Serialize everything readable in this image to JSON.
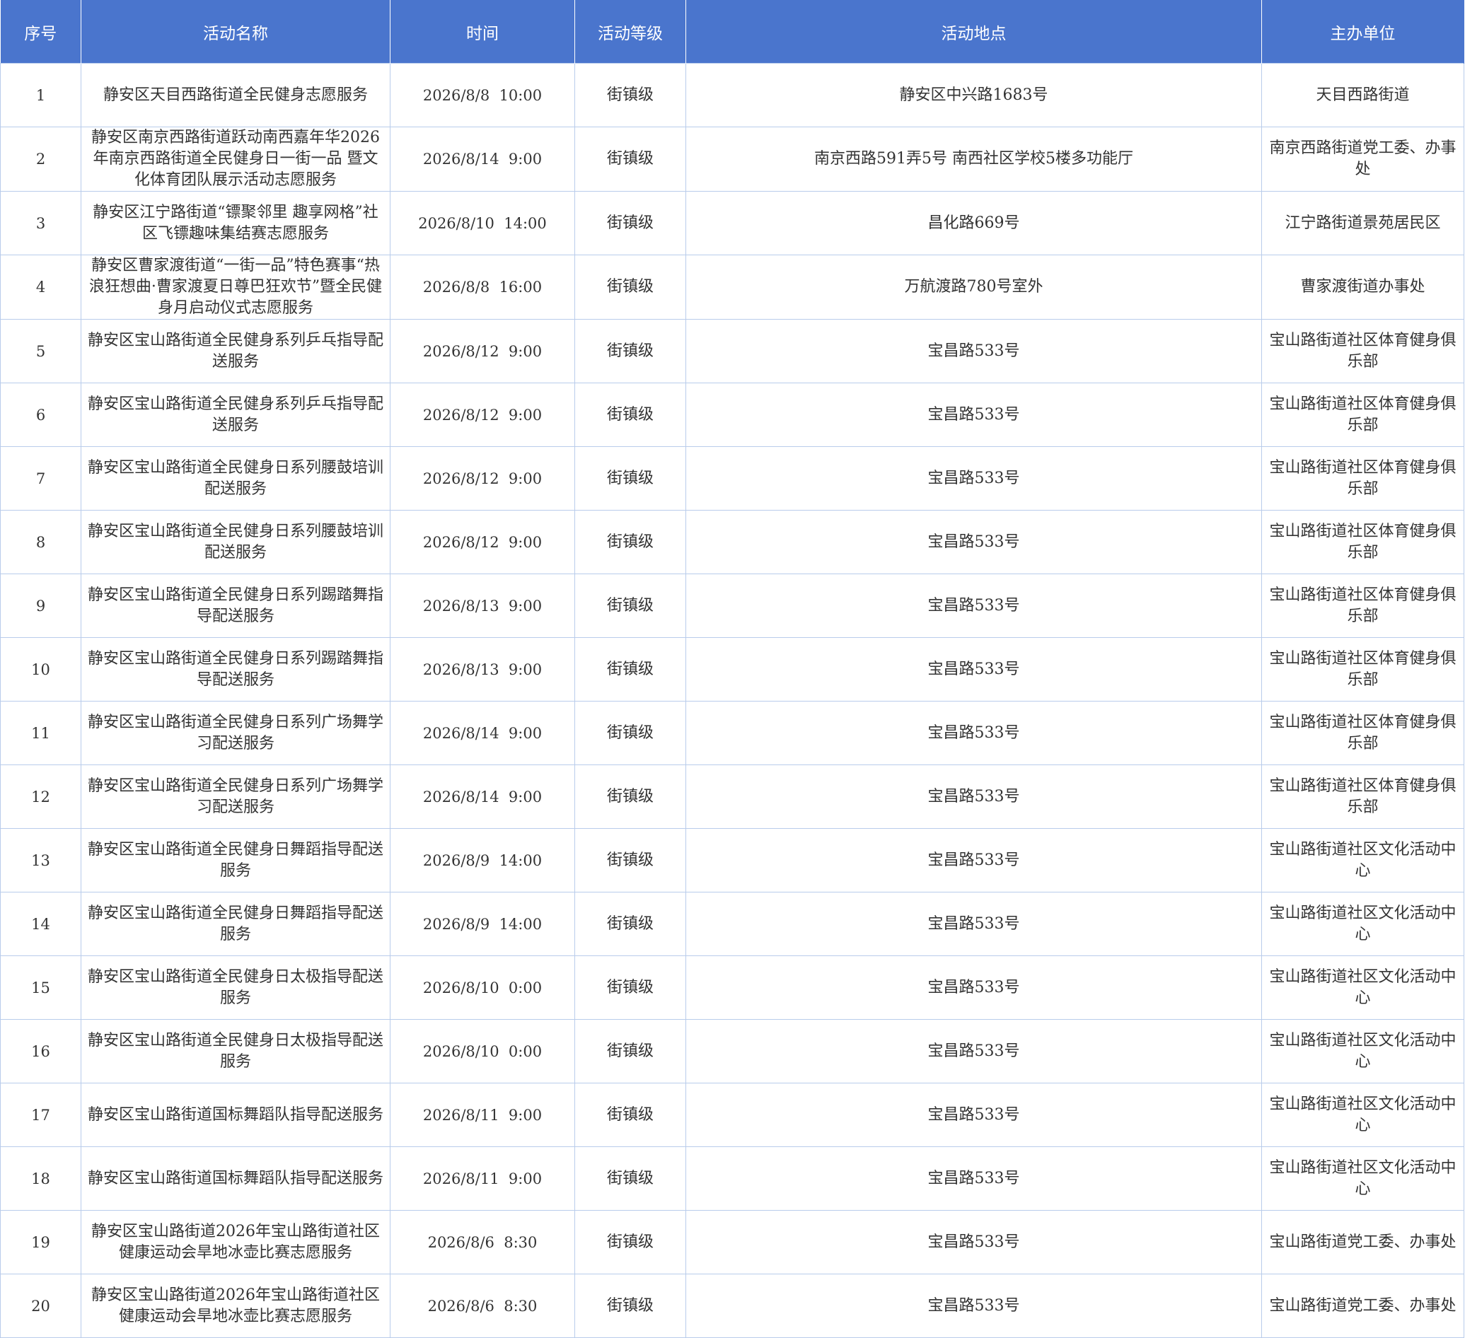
{
  "table": {
    "headers": [
      "序号",
      "活动名称",
      "时间",
      "活动等级",
      "活动地点",
      "主办单位"
    ],
    "rows": [
      [
        "1",
        "静安区天目西路街道全民健身志愿服务",
        "2026/8/8  10:00",
        "街镇级",
        "静安区中兴路1683号",
        "天目西路街道"
      ],
      [
        "2",
        "静安区南京西路街道跃动南西嘉年华2026年南京西路街道全民健身日一街一品 暨文化体育团队展示活动志愿服务",
        "2026/8/14  9:00",
        "街镇级",
        "南京西路591弄5号 南西社区学校5楼多功能厅",
        "南京西路街道党工委、办事处"
      ],
      [
        "3",
        "静安区江宁路街道“镖聚邻里 趣享网格”社区飞镖趣味集结赛志愿服务",
        "2026/8/10  14:00",
        "街镇级",
        "昌化路669号",
        "江宁路街道景苑居民区"
      ],
      [
        "4",
        "静安区曹家渡街道“一街一品”特色赛事“热浪狂想曲·曹家渡夏日尊巴狂欢节”暨全民健身月启动仪式志愿服务",
        "2026/8/8  16:00",
        "街镇级",
        "万航渡路780号室外",
        "曹家渡街道办事处"
      ],
      [
        "5",
        "静安区宝山路街道全民健身系列乒乓指导配送服务",
        "2026/8/12  9:00",
        "街镇级",
        "宝昌路533号",
        "宝山路街道社区体育健身俱乐部"
      ],
      [
        "6",
        "静安区宝山路街道全民健身系列乒乓指导配送服务",
        "2026/8/12  9:00",
        "街镇级",
        "宝昌路533号",
        "宝山路街道社区体育健身俱乐部"
      ],
      [
        "7",
        "静安区宝山路街道全民健身日系列腰鼓培训配送服务",
        "2026/8/12  9:00",
        "街镇级",
        "宝昌路533号",
        "宝山路街道社区体育健身俱乐部"
      ],
      [
        "8",
        "静安区宝山路街道全民健身日系列腰鼓培训配送服务",
        "2026/8/12  9:00",
        "街镇级",
        "宝昌路533号",
        "宝山路街道社区体育健身俱乐部"
      ],
      [
        "9",
        "静安区宝山路街道全民健身日系列踢踏舞指导配送服务",
        "2026/8/13  9:00",
        "街镇级",
        "宝昌路533号",
        "宝山路街道社区体育健身俱乐部"
      ],
      [
        "10",
        "静安区宝山路街道全民健身日系列踢踏舞指导配送服务",
        "2026/8/13  9:00",
        "街镇级",
        "宝昌路533号",
        "宝山路街道社区体育健身俱乐部"
      ],
      [
        "11",
        "静安区宝山路街道全民健身日系列广场舞学习配送服务",
        "2026/8/14  9:00",
        "街镇级",
        "宝昌路533号",
        "宝山路街道社区体育健身俱乐部"
      ],
      [
        "12",
        "静安区宝山路街道全民健身日系列广场舞学习配送服务",
        "2026/8/14  9:00",
        "街镇级",
        "宝昌路533号",
        "宝山路街道社区体育健身俱乐部"
      ],
      [
        "13",
        "静安区宝山路街道全民健身日舞蹈指导配送服务",
        "2026/8/9  14:00",
        "街镇级",
        "宝昌路533号",
        "宝山路街道社区文化活动中心"
      ],
      [
        "14",
        "静安区宝山路街道全民健身日舞蹈指导配送服务",
        "2026/8/9  14:00",
        "街镇级",
        "宝昌路533号",
        "宝山路街道社区文化活动中心"
      ],
      [
        "15",
        "静安区宝山路街道全民健身日太极指导配送服务",
        "2026/8/10  0:00",
        "街镇级",
        "宝昌路533号",
        "宝山路街道社区文化活动中心"
      ],
      [
        "16",
        "静安区宝山路街道全民健身日太极指导配送服务",
        "2026/8/10  0:00",
        "街镇级",
        "宝昌路533号",
        "宝山路街道社区文化活动中心"
      ],
      [
        "17",
        "静安区宝山路街道国标舞蹈队指导配送服务",
        "2026/8/11  9:00",
        "街镇级",
        "宝昌路533号",
        "宝山路街道社区文化活动中心"
      ],
      [
        "18",
        "静安区宝山路街道国标舞蹈队指导配送服务",
        "2026/8/11  9:00",
        "街镇级",
        "宝昌路533号",
        "宝山路街道社区文化活动中心"
      ],
      [
        "19",
        "静安区宝山路街道2026年宝山路街道社区健康运动会旱地冰壶比赛志愿服务",
        "2026/8/6  8:30",
        "街镇级",
        "宝昌路533号",
        "宝山路街道党工委、办事处"
      ],
      [
        "20",
        "静安区宝山路街道2026年宝山路街道社区健康运动会旱地冰壶比赛志愿服务",
        "2026/8/6  8:30",
        "街镇级",
        "宝昌路533号",
        "宝山路街道党工委、办事处"
      ]
    ]
  }
}
